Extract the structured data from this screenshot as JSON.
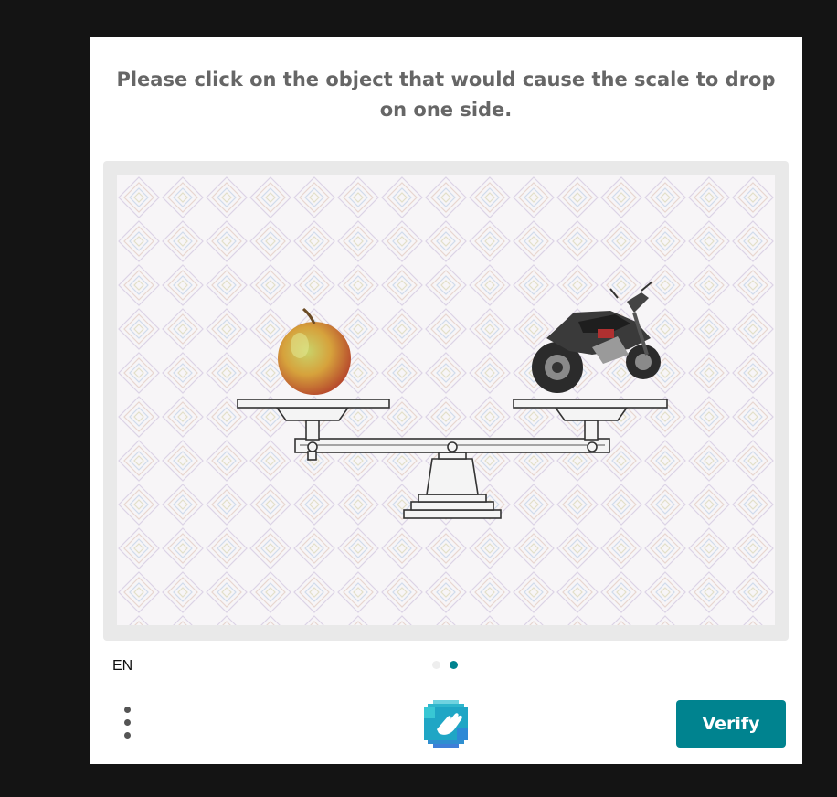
{
  "challenge": {
    "prompt": "Please click on the object that would cause the scale to drop on one side.",
    "objects": [
      {
        "name": "apple",
        "side": "left"
      },
      {
        "name": "motorcycle",
        "side": "right"
      }
    ]
  },
  "footer": {
    "language": "EN",
    "page_indicator": {
      "total": 2,
      "active": 2
    },
    "menu_icon": "vertical-ellipsis-icon",
    "logo_icon": "hcaptcha-hand-logo-icon",
    "verify_label": "Verify"
  },
  "colors": {
    "accent": "#00838f",
    "prompt_text": "#666666",
    "backdrop": "#141414",
    "frame": "#e9e9e9"
  }
}
